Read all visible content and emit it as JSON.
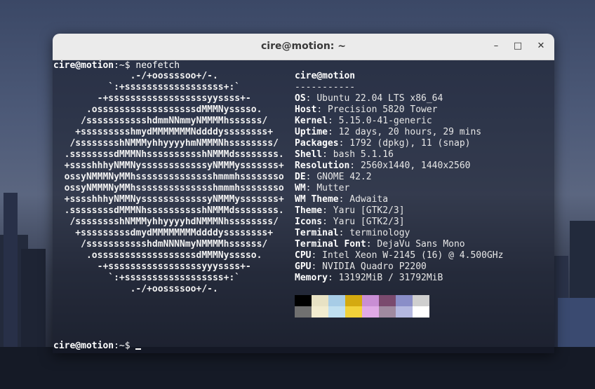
{
  "window": {
    "title": "cire@motion: ~",
    "buttons": {
      "minimize": "–",
      "maximize": "□",
      "close": "✕"
    }
  },
  "terminal": {
    "prompt_user": "cire@motion",
    "prompt_path": ":~$",
    "command": "neofetch",
    "final_prompt_user": "cire@motion",
    "final_prompt_path": ":~$"
  },
  "logo": "              .-/+oossssoo+/-.\n          `:+ssssssssssssssssss+:`\n        -+ssssssssssssssssssyyssss+-\n      .ossssssssssssssssssdMMMNysssso.\n     /ssssssssssshdmmNNmmyNMMMMhssssss/\n    +ssssssssshmydMMMMMMMNddddyssssssss+\n   /sssssssshNMMMyhhyyyyhmNMMMNhssssssss/\n  .ssssssssdMMMNhsssssssssshNMMMdssssssss.\n  +sssshhhyNMMNyssssssssssssyNMMMysssssss+\n  ossyNMMMNyMMhsssssssssssssshmmmhssssssso\n  ossyNMMMNyMMhsssssssssssssshmmmhssssssso\n  +sssshhhyNMMNyssssssssssssyNMMMysssssss+\n  .ssssssssdMMMNhsssssssssshNMMMdssssssss.\n   /sssssssshNMMMyhhyyyyhdNMMMNhssssssss/\n    +sssssssssdmydMMMMMMMMddddyssssssss+\n     /ssssssssssshdmNNNNmyNMMMMhssssss/\n      .ossssssssssssssssssdMMMNysssso.\n        -+sssssssssssssssssyyyssss+-\n          `:+ssssssssssssssssss+:`\n              .-/+oossssoo+/-.",
  "info": {
    "header": "cire@motion",
    "divider": "-----------",
    "rows": [
      {
        "key": "OS",
        "value": "Ubuntu 22.04 LTS x86_64"
      },
      {
        "key": "Host",
        "value": "Precision 5820 Tower"
      },
      {
        "key": "Kernel",
        "value": "5.15.0-41-generic"
      },
      {
        "key": "Uptime",
        "value": "12 days, 20 hours, 29 mins"
      },
      {
        "key": "Packages",
        "value": "1792 (dpkg), 11 (snap)"
      },
      {
        "key": "Shell",
        "value": "bash 5.1.16"
      },
      {
        "key": "Resolution",
        "value": "2560x1440, 1440x2560"
      },
      {
        "key": "DE",
        "value": "GNOME 42.2"
      },
      {
        "key": "WM",
        "value": "Mutter"
      },
      {
        "key": "WM Theme",
        "value": "Adwaita"
      },
      {
        "key": "Theme",
        "value": "Yaru [GTK2/3]"
      },
      {
        "key": "Icons",
        "value": "Yaru [GTK2/3]"
      },
      {
        "key": "Terminal",
        "value": "terminology"
      },
      {
        "key": "Terminal Font",
        "value": "DejaVu Sans Mono"
      },
      {
        "key": "CPU",
        "value": "Intel Xeon W-2145 (16) @ 4.500GHz"
      },
      {
        "key": "GPU",
        "value": "NVIDIA Quadro P2200"
      },
      {
        "key": "Memory",
        "value": "13192MiB / 31792MiB"
      }
    ]
  },
  "colors": {
    "row1": [
      "#000000",
      "#e8e2c4",
      "#a7cce6",
      "#d4aa10",
      "#c98ed4",
      "#7a4a6e",
      "#8a8ec8",
      "#cfcfcf"
    ],
    "row2": [
      "#707070",
      "#f2eccf",
      "#c0dff0",
      "#f2d23a",
      "#e0aae6",
      "#a08aa0",
      "#b4b8e0",
      "#ffffff"
    ]
  }
}
